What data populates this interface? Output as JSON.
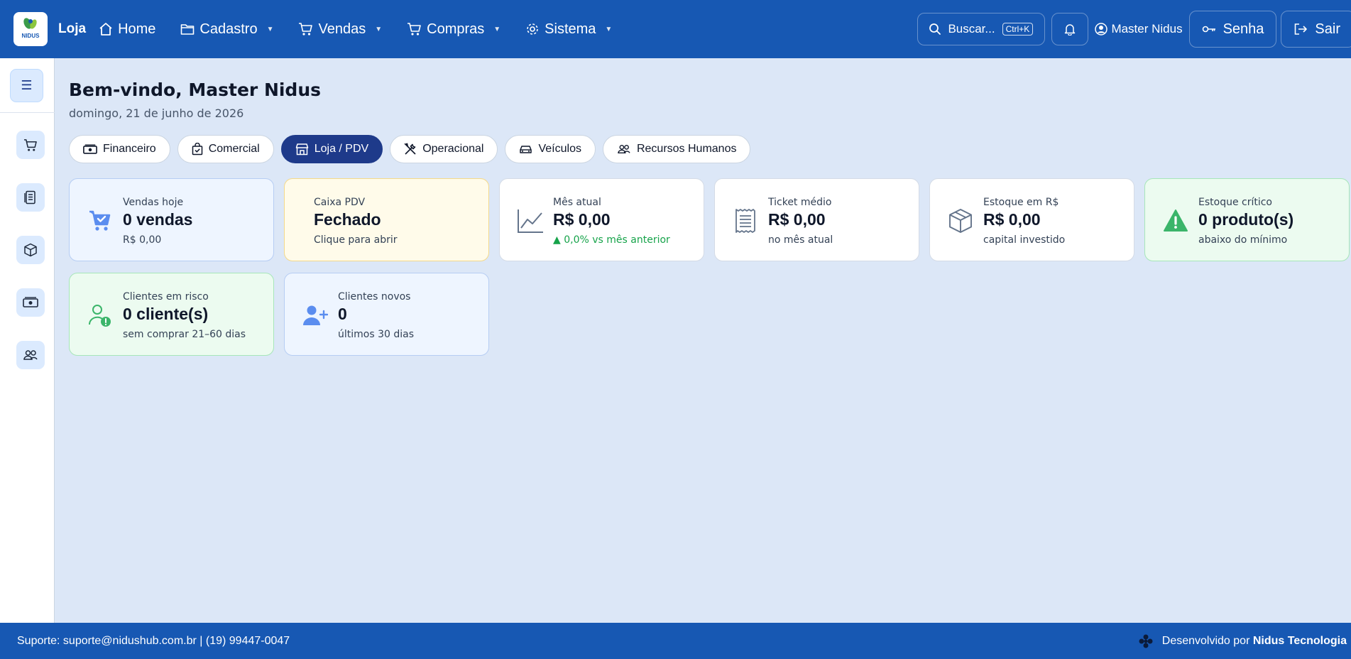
{
  "header": {
    "brand": "Loja",
    "logo_text": "NIDUS",
    "nav": [
      {
        "label": "Home",
        "icon": "home-icon",
        "dropdown": false
      },
      {
        "label": "Cadastro",
        "icon": "folder-icon",
        "dropdown": true
      },
      {
        "label": "Vendas",
        "icon": "cart-icon",
        "dropdown": true
      },
      {
        "label": "Compras",
        "icon": "cart-icon",
        "dropdown": true
      },
      {
        "label": "Sistema",
        "icon": "gear-icon",
        "dropdown": true
      }
    ],
    "caret": "▼",
    "search_label": "Buscar...",
    "search_shortcut": "Ctrl+K",
    "user_name": "Master Nidus",
    "password_label": "Senha",
    "logout_label": "Sair"
  },
  "sidebar": {
    "toggle_glyph": "☰",
    "items": [
      "cart-icon",
      "receipt-icon",
      "box-icon",
      "cash-icon",
      "people-icon"
    ]
  },
  "main": {
    "welcome": "Bem-vindo, Master Nidus",
    "date": "domingo, 21 de junho de 2026",
    "tabs": [
      {
        "label": "Financeiro",
        "icon": "cash-icon",
        "active": false
      },
      {
        "label": "Comercial",
        "icon": "bag-check-icon",
        "active": false
      },
      {
        "label": "Loja / PDV",
        "icon": "shop-icon",
        "active": true
      },
      {
        "label": "Operacional",
        "icon": "tools-icon",
        "active": false
      },
      {
        "label": "Veículos",
        "icon": "car-icon",
        "active": false
      },
      {
        "label": "Recursos Humanos",
        "icon": "people-icon",
        "active": false
      }
    ],
    "cards": [
      {
        "label": "Vendas hoje",
        "value": "0 vendas",
        "sub": "R$ 0,00",
        "icon": "cart-check-icon"
      },
      {
        "label": "Caixa PDV",
        "value": "Fechado",
        "sub": "Clique para abrir",
        "icon": ""
      },
      {
        "label": "Mês atual",
        "value": "R$ 0,00",
        "sub": "▲ 0,0% vs mês anterior",
        "icon": "line-chart-icon"
      },
      {
        "label": "Ticket médio",
        "value": "R$ 0,00",
        "sub": "no mês atual",
        "icon": "receipt-icon"
      },
      {
        "label": "Estoque em R$",
        "value": "R$ 0,00",
        "sub": "capital investido",
        "icon": "box-icon"
      },
      {
        "label": "Estoque crítico",
        "value": "0 produto(s)",
        "sub": "abaixo do mínimo",
        "icon": "warning-icon"
      },
      {
        "label": "Clientes em risco",
        "value": "0 cliente(s)",
        "sub": "sem comprar 21–60 dias",
        "icon": "person-alert-icon"
      },
      {
        "label": "Clientes novos",
        "value": "0",
        "sub": "últimos 30 dias",
        "icon": "person-add-icon"
      }
    ]
  },
  "footer": {
    "support": "Suporte: suporte@nidushub.com.br | (19) 99447-0047",
    "developed_prefix": "Desenvolvido por",
    "developed_company": "Nidus Tecnologia"
  },
  "colors": {
    "primary": "#1758b3",
    "active_tab": "#1e3a8a",
    "background": "#dce7f7",
    "success": "#16a34a"
  }
}
